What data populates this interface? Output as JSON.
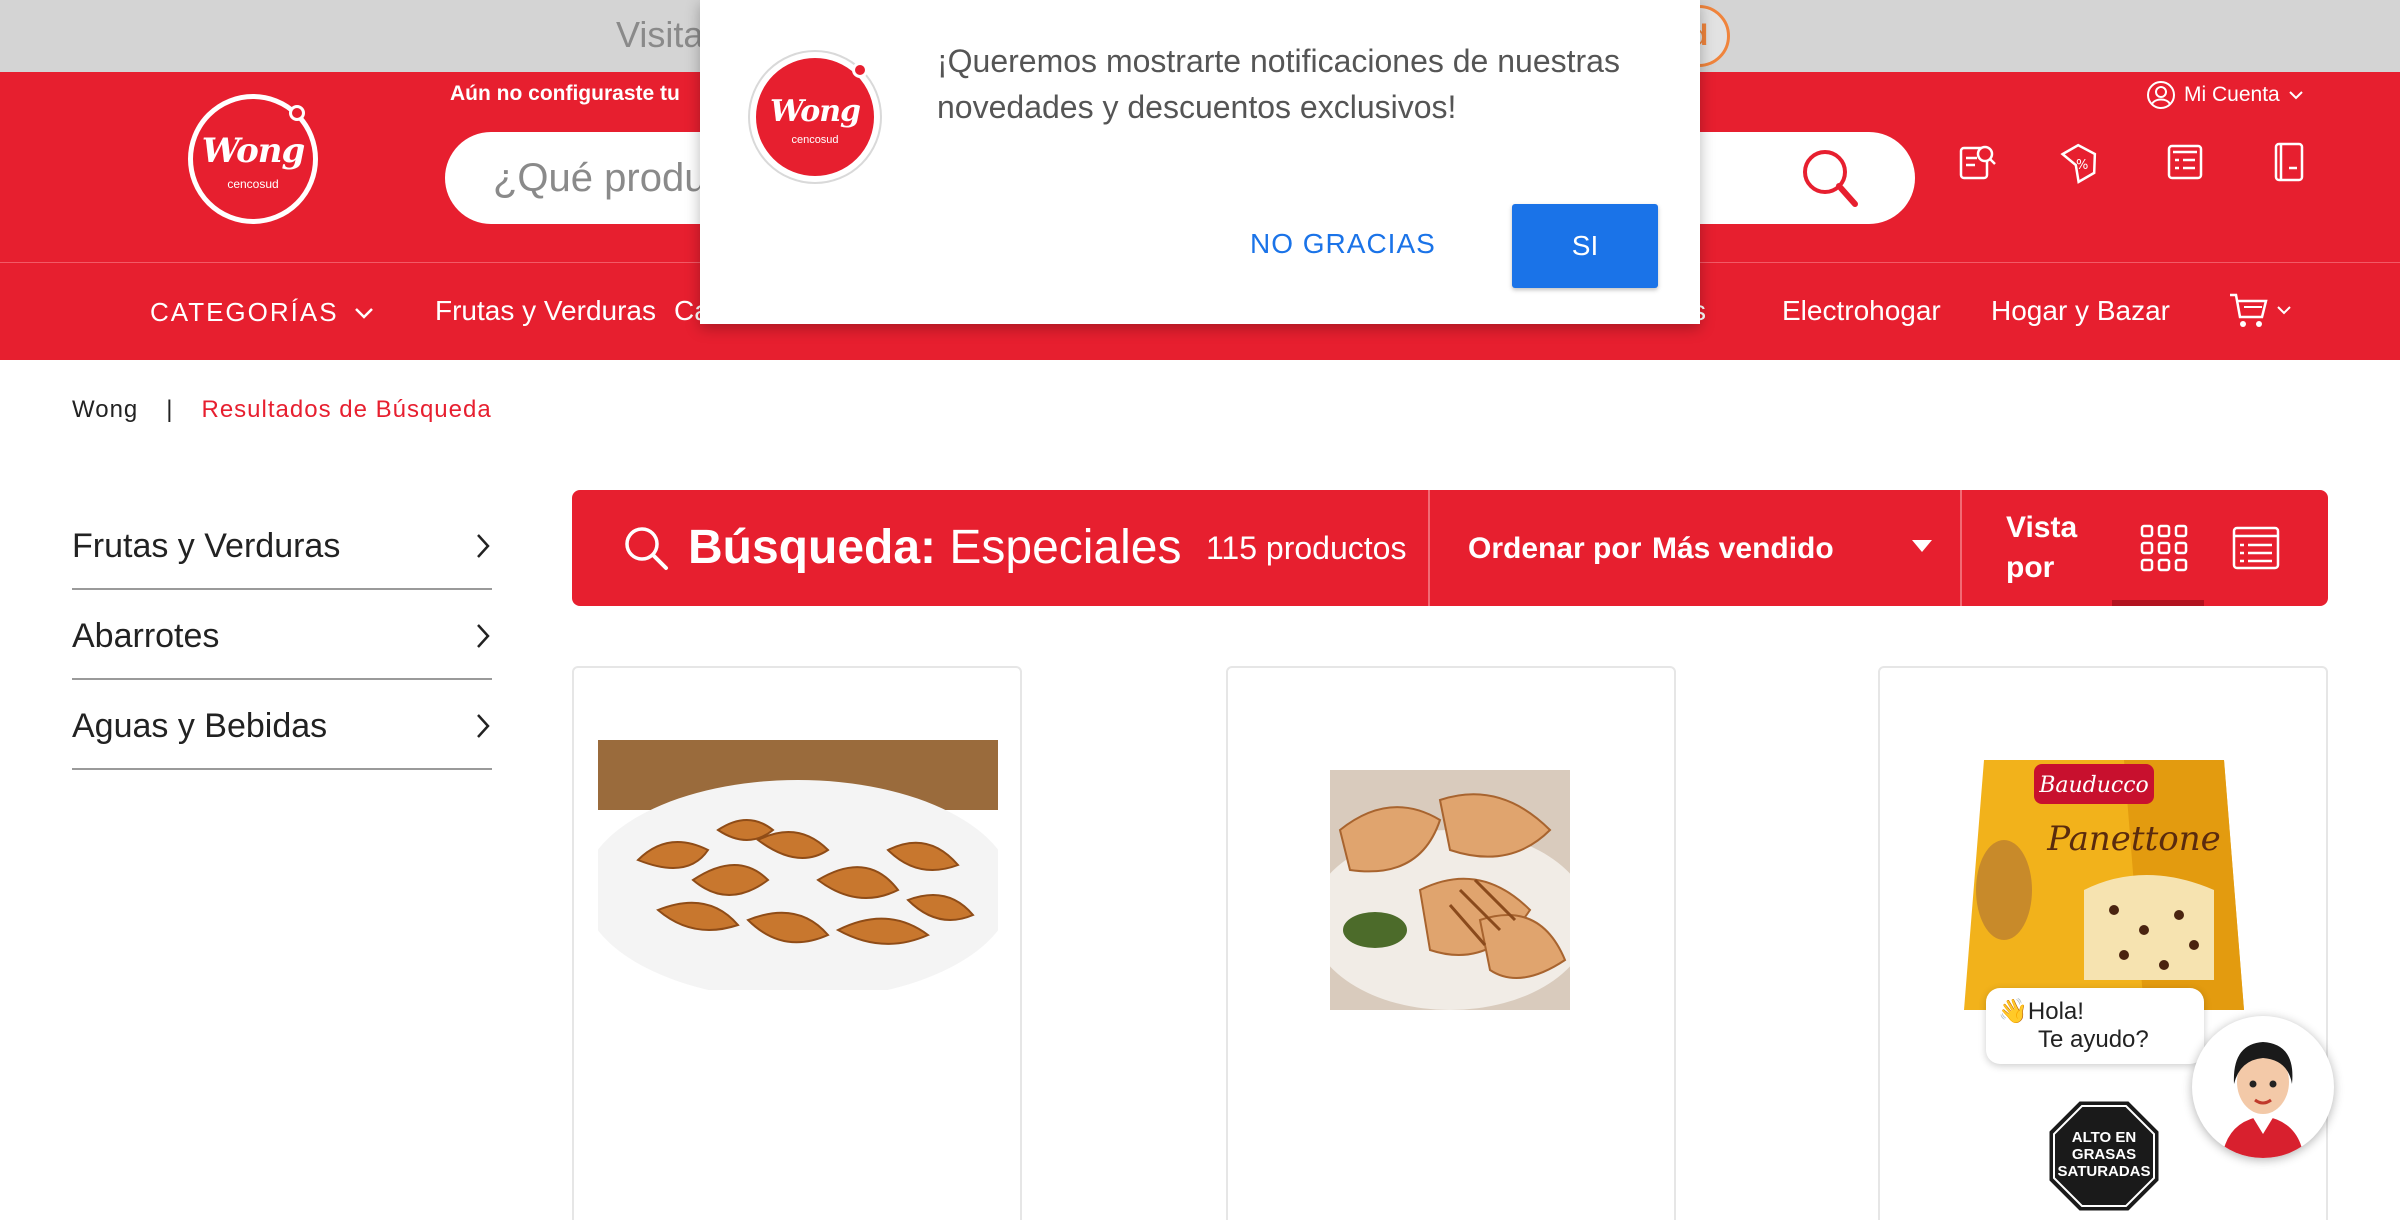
{
  "topbar": {
    "text": "Visita"
  },
  "brand": {
    "name": "Wong",
    "sub": "cencosud"
  },
  "header": {
    "config_text": "Aún no configuraste tu",
    "search_placeholder": "¿Qué productos buscas hoy?",
    "account_label": "Mi Cuenta"
  },
  "nav": {
    "categories_label": "CATEGORÍAS",
    "items": [
      "Frutas y Verduras",
      "Ca",
      "s",
      "Electrohogar",
      "Hogar y Bazar"
    ]
  },
  "breadcrumb": {
    "home": "Wong",
    "separator": "|",
    "current": "Resultados de Búsqueda"
  },
  "sidebar": {
    "items": [
      {
        "label": "Frutas y Verduras"
      },
      {
        "label": "Abarrotes"
      },
      {
        "label": "Aguas y Bebidas"
      }
    ]
  },
  "results": {
    "search_label": "Búsqueda:",
    "query": "Especiales",
    "count": "115 productos",
    "sort_label": "Ordenar por",
    "sort_value": "Más vendido",
    "view_label_1": "Vista",
    "view_label_2": "por"
  },
  "products": [
    {
      "image": "potato-wedges"
    },
    {
      "image": "grilled-chicken"
    },
    {
      "image": "bauducco-panettone",
      "brand_text": "Bauducco",
      "product_text": "Panettone",
      "warning": [
        "ALTO EN",
        "GRASAS",
        "SATURADAS"
      ]
    }
  ],
  "modal": {
    "message": "¡Queremos mostrarte notificaciones de nuestras novedades y descuentos exclusivos!",
    "no_label": "NO GRACIAS",
    "yes_label": "SI"
  },
  "chat": {
    "line1": "👋Hola!",
    "line2": "Te ayudo?"
  },
  "colors": {
    "brand_red": "#e71f2f",
    "modal_blue": "#1a73e8"
  }
}
